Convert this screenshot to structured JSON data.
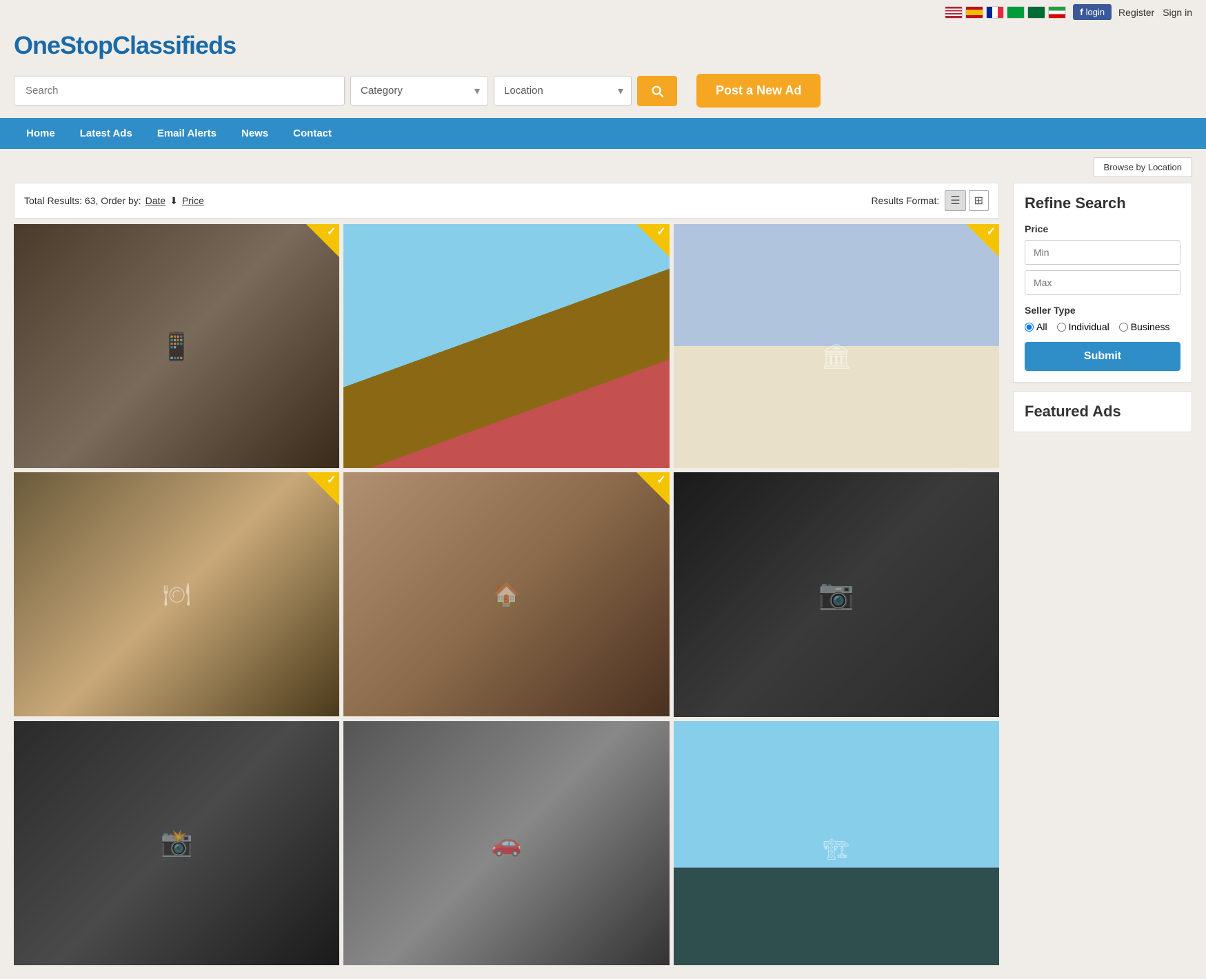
{
  "site": {
    "name": "OneStopClassifieds",
    "logo": "OneStopClassifieds"
  },
  "topbar": {
    "login_label": "login",
    "register_label": "Register",
    "signin_label": "Sign in",
    "flags": [
      "us",
      "es",
      "fr",
      "br",
      "sa",
      "ir"
    ]
  },
  "header": {
    "search_placeholder": "Search",
    "category_placeholder": "Category",
    "location_placeholder": "Location",
    "search_button_label": "Search",
    "post_ad_label": "Post a New Ad"
  },
  "nav": {
    "items": [
      {
        "label": "Home"
      },
      {
        "label": "Latest Ads"
      },
      {
        "label": "Email Alerts"
      },
      {
        "label": "News"
      },
      {
        "label": "Contact"
      }
    ]
  },
  "browse": {
    "button_label": "Browse by Location"
  },
  "results": {
    "summary": "Total Results: 63, Order by:",
    "order_date": "Date",
    "order_price": "Price",
    "format_label": "Results Format:",
    "items": [
      {
        "id": 1,
        "bg": "#6a5a4a",
        "featured": true
      },
      {
        "id": 2,
        "bg": "#7a8a6a",
        "featured": true
      },
      {
        "id": 3,
        "bg": "#8a9aaa",
        "featured": true
      },
      {
        "id": 4,
        "bg": "#5a6a4a",
        "featured": true
      },
      {
        "id": 5,
        "bg": "#9a7a5a",
        "featured": true
      },
      {
        "id": 6,
        "bg": "#2a2a2a",
        "featured": false
      },
      {
        "id": 7,
        "bg": "#3a3a3a",
        "featured": false
      },
      {
        "id": 8,
        "bg": "#4a4a4a",
        "featured": false
      },
      {
        "id": 9,
        "bg": "#7a8a7a",
        "featured": false
      }
    ]
  },
  "sidebar": {
    "refine_title": "Refine Search",
    "price_label": "Price",
    "price_min_placeholder": "Min",
    "price_max_placeholder": "Max",
    "seller_type_label": "Seller Type",
    "seller_types": [
      "All",
      "Individual",
      "Business"
    ],
    "submit_label": "Submit",
    "featured_ads_title": "Featured Ads"
  }
}
